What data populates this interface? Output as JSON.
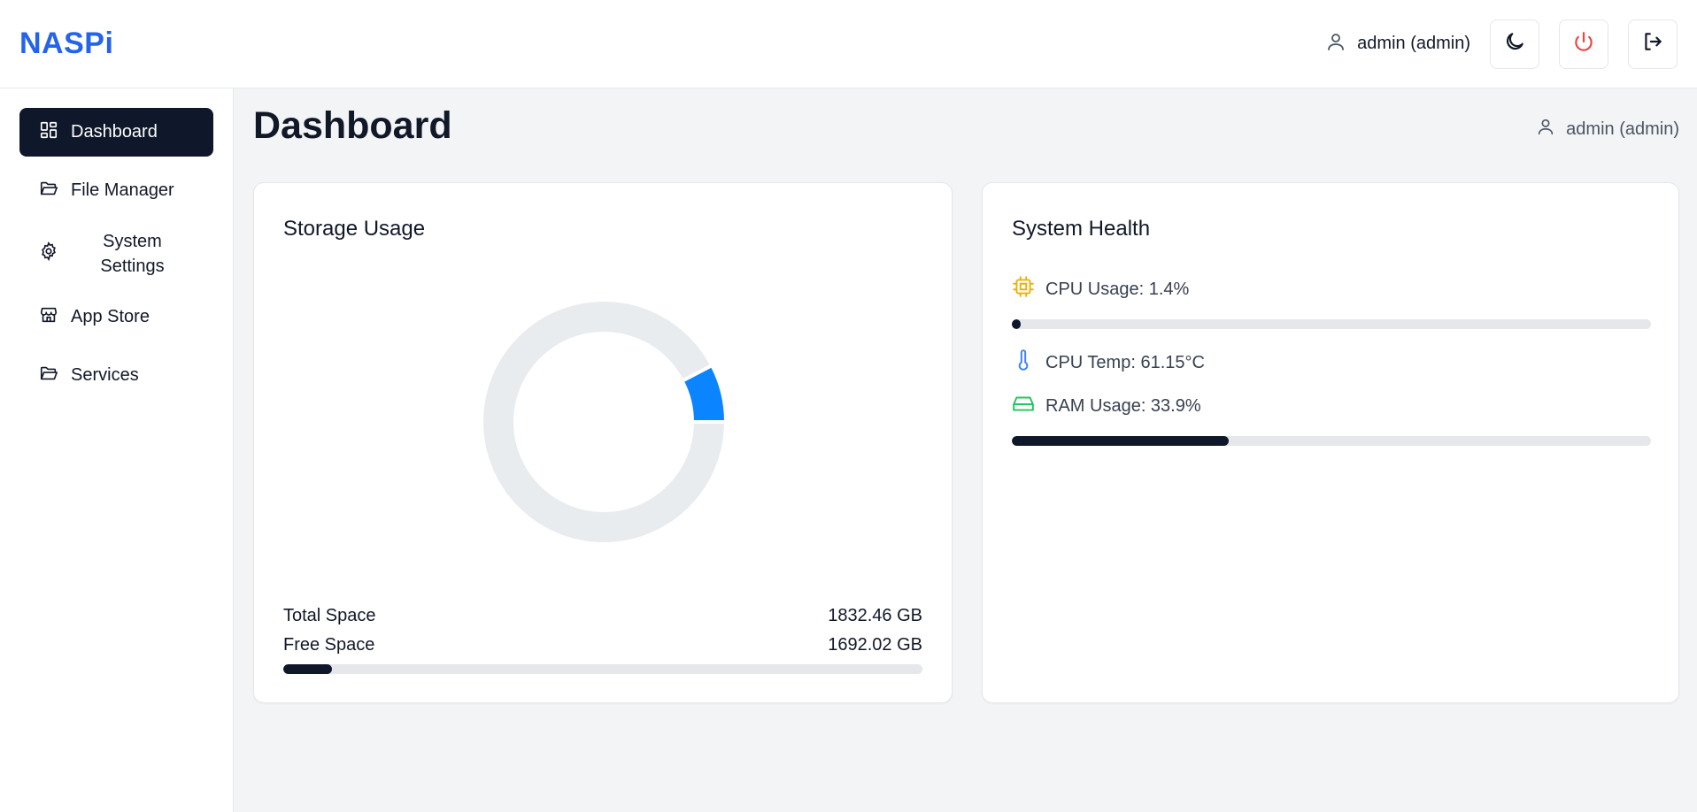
{
  "brand": "NASPi",
  "header": {
    "user_label": "admin (admin)"
  },
  "sidebar": {
    "items": [
      {
        "label": "Dashboard",
        "icon": "dashboard-icon",
        "active": true
      },
      {
        "label": "File Manager",
        "icon": "folder-open-icon",
        "active": false
      },
      {
        "label": "System Settings",
        "label_line1": "System",
        "label_line2": "Settings",
        "icon": "gear-icon",
        "active": false
      },
      {
        "label": "App Store",
        "icon": "store-icon",
        "active": false
      },
      {
        "label": "Services",
        "icon": "folder-open-icon",
        "active": false
      }
    ]
  },
  "main": {
    "title": "Dashboard",
    "user_label": "admin (admin)"
  },
  "storage": {
    "title": "Storage Usage",
    "total_label": "Total Space",
    "total_value": "1832.46 GB",
    "free_label": "Free Space",
    "free_value": "1692.02 GB",
    "used_fraction": 0.0766
  },
  "health": {
    "title": "System Health",
    "cpu_usage_label": "CPU Usage: 1.4%",
    "cpu_usage_fraction": 0.014,
    "cpu_temp_label": "CPU Temp: 61.15°C",
    "ram_usage_label": "RAM Usage: 33.9%",
    "ram_usage_fraction": 0.339
  },
  "colors": {
    "brand": "#2563eb",
    "donut_used": "#0a84ff",
    "donut_track": "#e9ecef",
    "bar_fill": "#0f172a",
    "cpu_icon": "#eab308",
    "temp_icon": "#3b82f6",
    "ram_icon": "#22c55e",
    "power_icon": "#ef4444"
  }
}
